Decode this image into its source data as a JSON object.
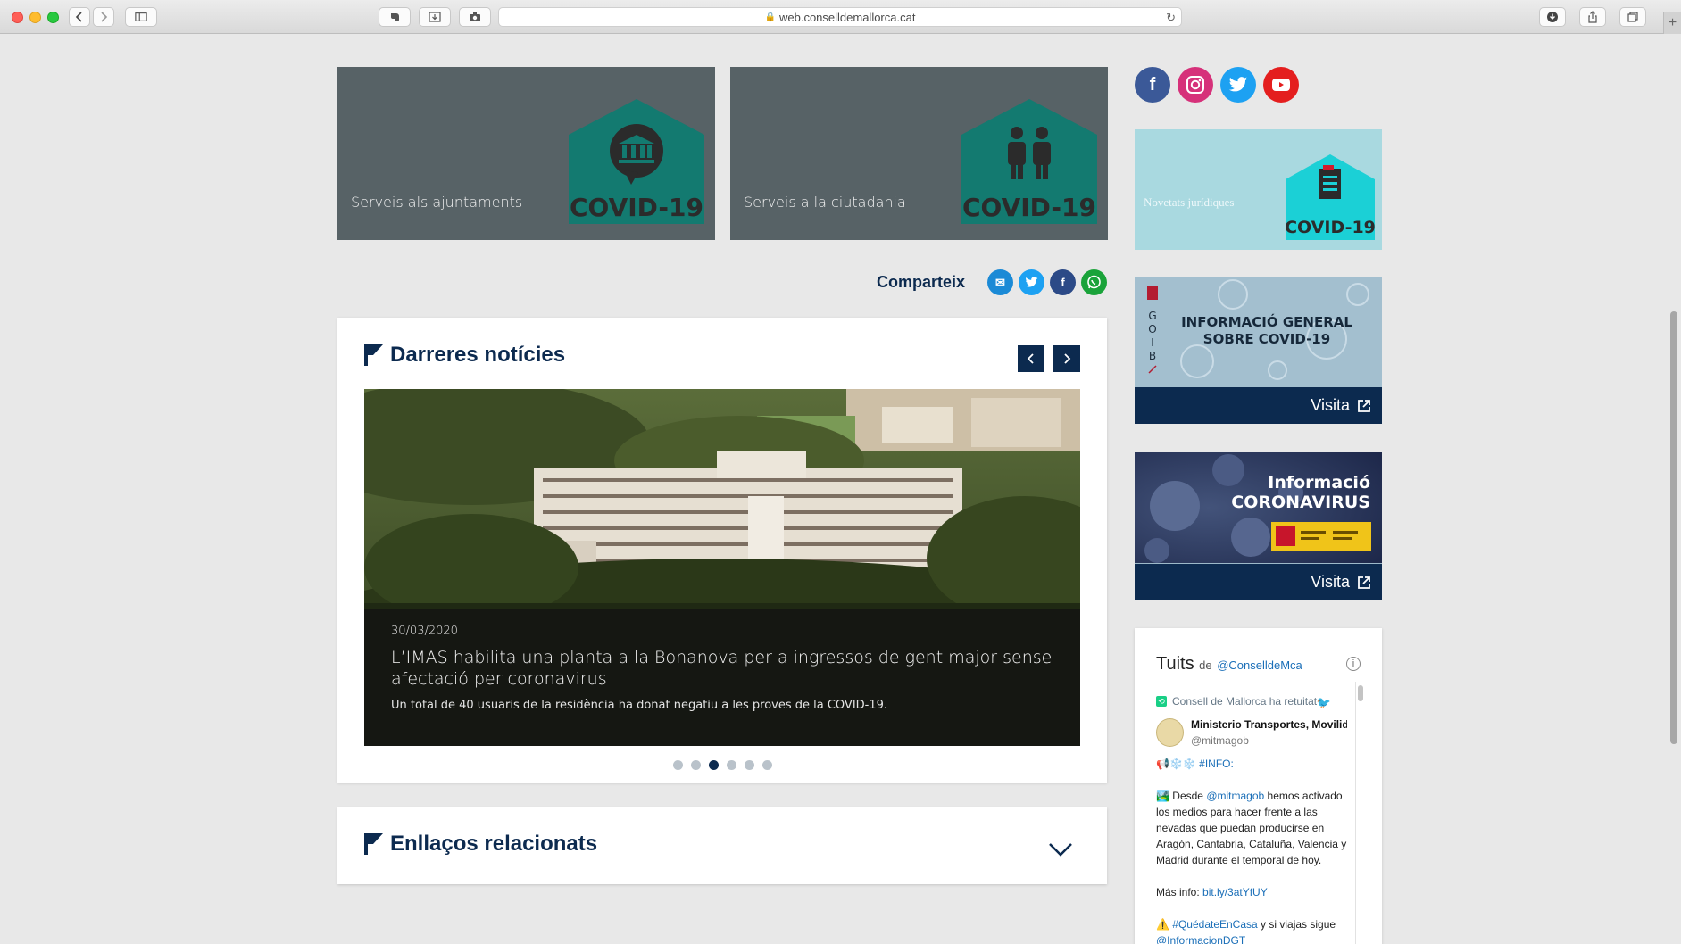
{
  "browser": {
    "url": "web.conselldemallorca.cat"
  },
  "tiles": [
    {
      "label": "Serveis als ajuntaments",
      "badge": "COVID-19"
    },
    {
      "label": "Serveis a la ciutadania",
      "badge": "COVID-19"
    }
  ],
  "social": [
    {
      "name": "facebook",
      "color": "#3b5998"
    },
    {
      "name": "instagram",
      "color": "#d6317a"
    },
    {
      "name": "twitter",
      "color": "#1da1f2"
    },
    {
      "name": "youtube",
      "color": "#e41e1e"
    }
  ],
  "side_tile": {
    "label": "Novetats jurídiques",
    "badge": "COVID-19"
  },
  "banners": [
    {
      "title_line1": "INFORMACIÓ GENERAL",
      "title_line2": "SOBRE COVID-19",
      "brand": "GOIB",
      "cta": "Visita"
    },
    {
      "title_line1": "Informació",
      "title_line2": "CORONAVIRUS",
      "cta": "Visita"
    }
  ],
  "share": {
    "label": "Comparteix",
    "buttons": [
      {
        "name": "email",
        "color": "#1b8ad6",
        "glyph": "✉"
      },
      {
        "name": "twitter",
        "color": "#1da1f2",
        "glyph": "t"
      },
      {
        "name": "facebook",
        "color": "#2c4a87",
        "glyph": "f"
      },
      {
        "name": "whatsapp",
        "color": "#1aa33a",
        "glyph": "☎"
      }
    ]
  },
  "news": {
    "title": "Darreres notícies",
    "date": "30/03/2020",
    "headline": "L’IMAS habilita una planta a la Bonanova per a ingressos de gent major sense afectació per coronavirus",
    "summary": "Un total de 40 usuaris de la residència ha donat negatiu a les proves de la COVID-19.",
    "slide_count": 6,
    "active_slide": 3
  },
  "links": {
    "title": "Enllaços relacionats"
  },
  "tweets": {
    "title": "Tuits",
    "by": "de",
    "handle": "@ConselldeMca",
    "retweet_label": "Consell de Mallorca ha retuitat",
    "author_name": "Ministerio Transportes, Movilid",
    "author_handle": "@mitmagob",
    "line1_tag": "#INFO:",
    "line2_pre": "Desde",
    "line2_handle": "@mitmagob",
    "line2_rest": "hemos activado los medios para hacer frente a las nevadas que puedan producirse en Aragón, Cantabria, Cataluña, Valencia y Madrid durante el temporal de hoy.",
    "more_label": "Más info:",
    "more_link": "bit.ly/3atYfUY",
    "line4_tag": "#QuédateEnCasa",
    "line4_rest": "y si viajas sigue",
    "line4_handle": "@InformacionDGT"
  }
}
